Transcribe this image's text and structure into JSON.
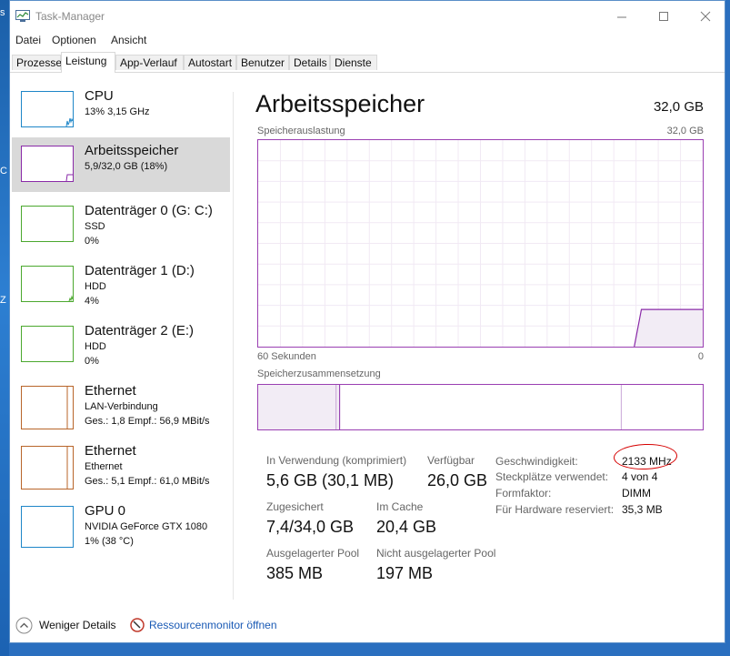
{
  "window": {
    "title": "Task-Manager"
  },
  "menu": [
    "Datei",
    "Optionen",
    "Ansicht"
  ],
  "tabs": [
    "Prozesse",
    "Leistung",
    "App-Verlauf",
    "Autostart",
    "Benutzer",
    "Details",
    "Dienste"
  ],
  "active_tab": "Leistung",
  "sidebar": [
    {
      "title": "CPU",
      "sub1": "13%  3,15 GHz",
      "color": "#1e86c8",
      "selected": false
    },
    {
      "title": "Arbeitsspeicher",
      "sub1": "5,9/32,0 GB (18%)",
      "color": "#8a2aa8",
      "selected": true
    },
    {
      "title": "Datenträger 0 (G: C:)",
      "sub1": "SSD",
      "sub2": "0%",
      "color": "#4ba82e",
      "selected": false
    },
    {
      "title": "Datenträger 1 (D:)",
      "sub1": "HDD",
      "sub2": "4%",
      "color": "#4ba82e",
      "selected": false
    },
    {
      "title": "Datenträger 2 (E:)",
      "sub1": "HDD",
      "sub2": "0%",
      "color": "#4ba82e",
      "selected": false
    },
    {
      "title": "Ethernet",
      "sub1": "LAN-Verbindung",
      "sub2": "Ges.: 1,8  Empf.: 56,9 MBit/s",
      "color": "#b8652a",
      "selected": false
    },
    {
      "title": "Ethernet",
      "sub1": "Ethernet",
      "sub2": "Ges.: 5,1  Empf.: 61,0 MBit/s",
      "color": "#b8652a",
      "selected": false
    },
    {
      "title": "GPU 0",
      "sub1": "NVIDIA GeForce GTX 1080",
      "sub2": "1% (38 °C)",
      "color": "#1e86c8",
      "selected": false
    }
  ],
  "main": {
    "title": "Arbeitsspeicher",
    "total": "32,0 GB",
    "graph_label": "Speicherauslastung",
    "graph_max": "32,0 GB",
    "graph_time": "60 Sekunden",
    "graph_min": "0",
    "graph_color": "#8a2aa8",
    "current_usage_fraction": 0.18,
    "composition_label": "Speicherzusammensetzung",
    "stats": {
      "in_use_label": "In Verwendung (komprimiert)",
      "in_use_value": "5,6 GB (30,1 MB)",
      "available_label": "Verfügbar",
      "available_value": "26,0 GB",
      "committed_label": "Zugesichert",
      "committed_value": "7,4/34,0 GB",
      "cached_label": "Im Cache",
      "cached_value": "20,4 GB",
      "paged_label": "Ausgelagerter Pool",
      "paged_value": "385 MB",
      "nonpaged_label": "Nicht ausgelagerter Pool",
      "nonpaged_value": "197 MB"
    },
    "details": {
      "speed_label": "Geschwindigkeit:",
      "speed_value": "2133 MHz",
      "slots_label": "Steckplätze verwendet:",
      "slots_value": "4 von 4",
      "form_label": "Formfaktor:",
      "form_value": "DIMM",
      "reserved_label": "Für Hardware reserviert:",
      "reserved_value": "35,3 MB"
    }
  },
  "footer": {
    "fewer_details": "Weniger Details",
    "resource_monitor": "Ressourcenmonitor öffnen"
  }
}
